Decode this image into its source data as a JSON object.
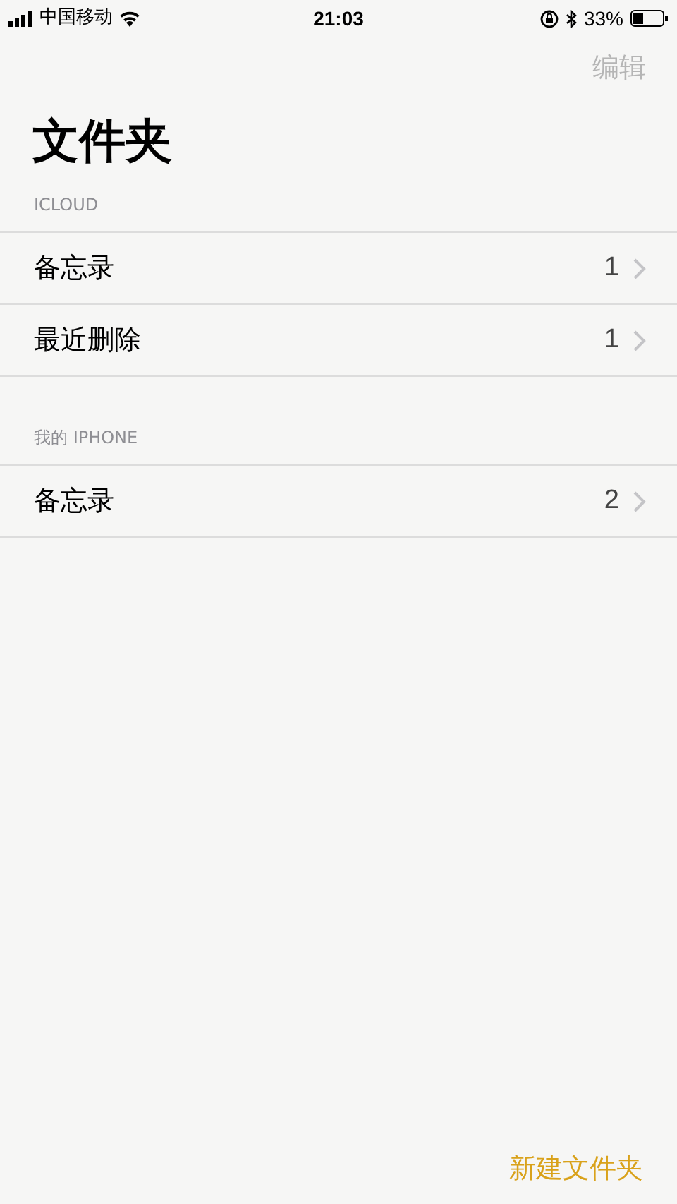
{
  "status_bar": {
    "carrier": "中国移动",
    "time": "21:03",
    "battery": "33%"
  },
  "nav": {
    "edit": {
      "label": "编辑",
      "disabled": true
    }
  },
  "title": "文件夹",
  "sections": [
    {
      "header": "ICLOUD",
      "items": [
        {
          "name": "备忘录",
          "count": "1"
        },
        {
          "name": "最近删除",
          "count": "1"
        }
      ]
    },
    {
      "header": "我的 IPHONE",
      "items": [
        {
          "name": "备忘录",
          "count": "2"
        }
      ]
    }
  ],
  "toolbar": {
    "new_folder": "新建文件夹"
  }
}
